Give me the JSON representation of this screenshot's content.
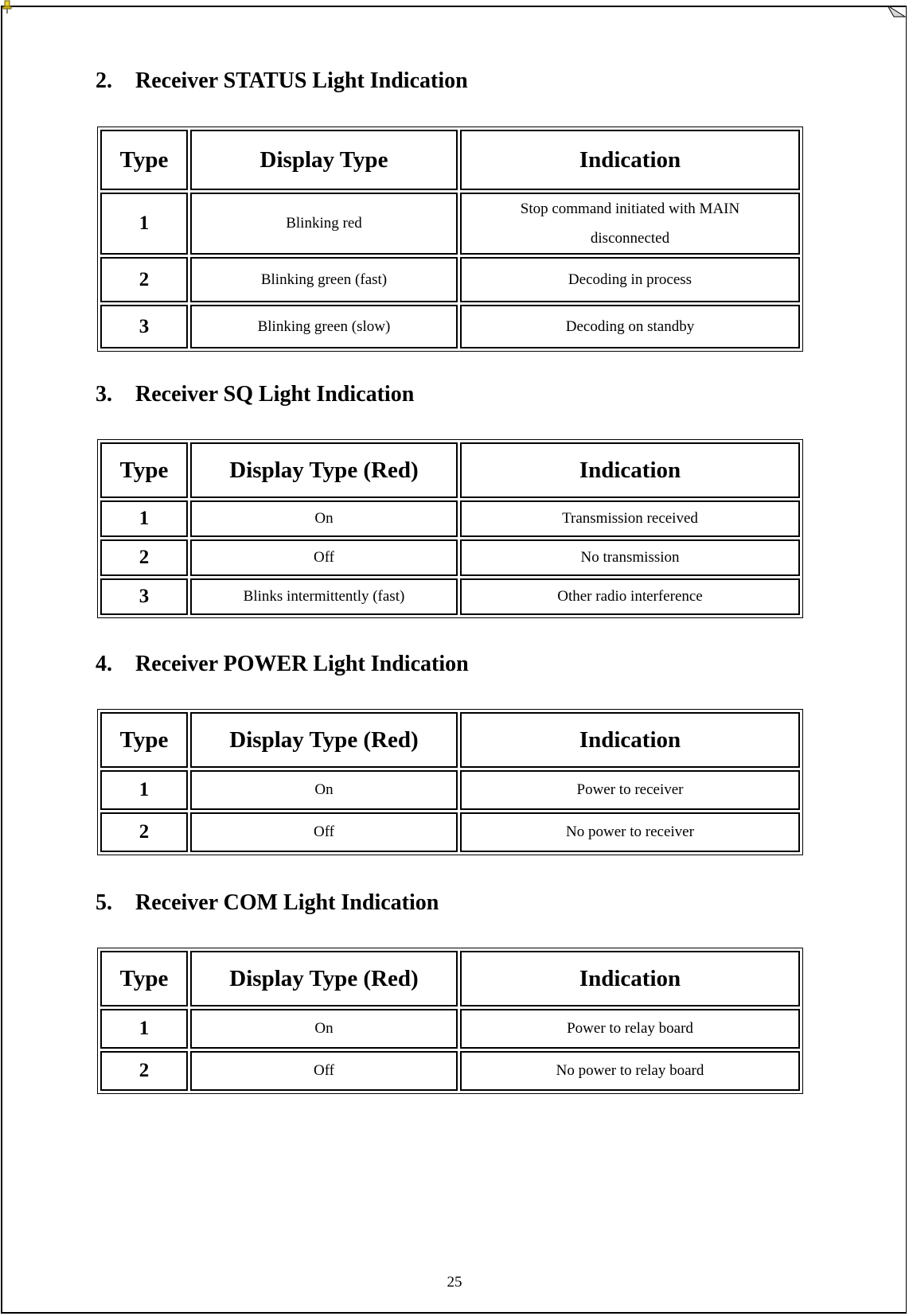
{
  "page_number": "25",
  "sections": [
    {
      "number": "2.",
      "title": "Receiver STATUS Light Indication",
      "headers": [
        "Type",
        "Display Type",
        "Indication"
      ],
      "rows": [
        {
          "type": "1",
          "display": "Blinking red",
          "indication": "Stop command initiated with MAIN disconnected"
        },
        {
          "type": "2",
          "display": "Blinking green (fast)",
          "indication": "Decoding in process"
        },
        {
          "type": "3",
          "display": "Blinking green (slow)",
          "indication": "Decoding on standby"
        }
      ]
    },
    {
      "number": "3.",
      "title": "Receiver SQ Light Indication",
      "headers": [
        "Type",
        "Display Type (Red)",
        "Indication"
      ],
      "rows": [
        {
          "type": "1",
          "display": "On",
          "indication": "Transmission received"
        },
        {
          "type": "2",
          "display": "Off",
          "indication": "No transmission"
        },
        {
          "type": "3",
          "display": "Blinks intermittently (fast)",
          "indication": "Other radio interference"
        }
      ]
    },
    {
      "number": "4.",
      "title": "Receiver POWER Light Indication",
      "headers": [
        "Type",
        "Display Type (Red)",
        "Indication"
      ],
      "rows": [
        {
          "type": "1",
          "display": "On",
          "indication": "Power to receiver"
        },
        {
          "type": "2",
          "display": "Off",
          "indication": "No power to receiver"
        }
      ]
    },
    {
      "number": "5.",
      "title": "Receiver COM Light Indication",
      "headers": [
        "Type",
        "Display Type (Red)",
        "Indication"
      ],
      "rows": [
        {
          "type": "1",
          "display": "On",
          "indication": "Power to relay board"
        },
        {
          "type": "2",
          "display": "Off",
          "indication": "No power to relay board"
        }
      ]
    }
  ]
}
